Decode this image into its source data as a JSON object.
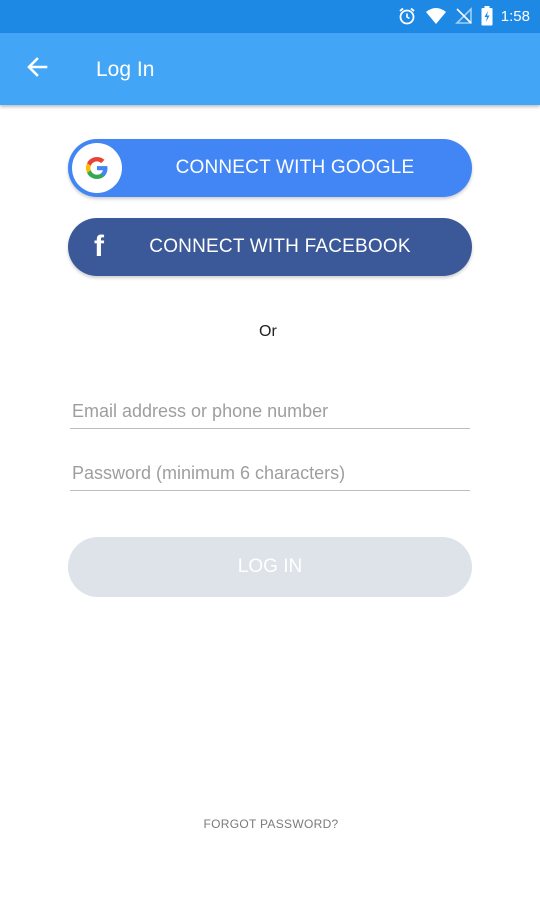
{
  "status_bar": {
    "time": "1:58",
    "icons": [
      "alarm-icon",
      "wifi-icon",
      "no-sim-icon",
      "battery-charging-icon"
    ]
  },
  "app_bar": {
    "title": "Log In",
    "back_icon": "arrow-back-icon"
  },
  "social": {
    "google_label": "CONNECT WITH GOOGLE",
    "facebook_label": "CONNECT WITH FACEBOOK",
    "facebook_glyph": "f"
  },
  "divider_text": "Or",
  "form": {
    "email_placeholder": "Email address or phone number",
    "email_value": "",
    "password_placeholder": "Password (minimum 6 characters)",
    "password_value": "",
    "login_label": "LOG IN"
  },
  "forgot_password": "FORGOT PASSWORD?",
  "colors": {
    "status_bar": "#1e88e5",
    "app_bar": "#42a5f5",
    "google": "#4285f4",
    "facebook": "#3b5998",
    "login_disabled": "#dde3e8"
  }
}
